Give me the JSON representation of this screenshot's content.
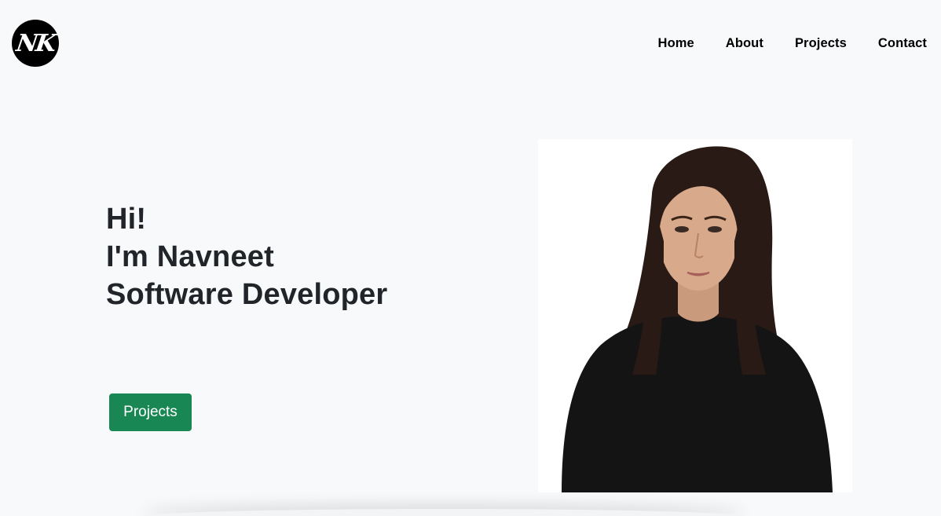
{
  "logo": {
    "text": "NK"
  },
  "nav": {
    "items": [
      {
        "label": "Home"
      },
      {
        "label": "About"
      },
      {
        "label": "Projects"
      },
      {
        "label": "Contact"
      }
    ]
  },
  "hero": {
    "lines": [
      "Hi!",
      "I'm Navneet",
      "Software Developer"
    ],
    "button_label": "Projects"
  },
  "colors": {
    "background": "#f8f9fa",
    "button": "#198754",
    "heading": "#212529"
  }
}
